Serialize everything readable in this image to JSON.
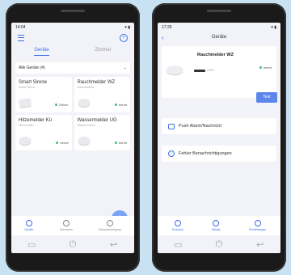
{
  "left": {
    "status_time": "14:04",
    "status_icons": "▾ ▮",
    "add_symbol": "+",
    "tabs": [
      {
        "label": "Geräte"
      },
      {
        "label": "Zimmer"
      }
    ],
    "filter": {
      "label": "Alle Geräte (4)",
      "chevron": "⌄"
    },
    "devices": [
      {
        "name": "Smart Sirene",
        "sub": "Smart Sirene",
        "status": "Online"
      },
      {
        "name": "Rauchmelder WZ",
        "sub": "Rauchmelder",
        "status": "bereit"
      },
      {
        "name": "Hitzemelder Kü",
        "sub": "Hitzemelder",
        "status": "bereit"
      },
      {
        "name": "Wassermelder UG",
        "sub": "Wassermelder",
        "status": "bereit"
      }
    ],
    "fab_label": "+",
    "bottom_nav": [
      {
        "label": "Geräte"
      },
      {
        "label": "Szenarien"
      },
      {
        "label": "Benachrichtigung"
      }
    ],
    "sys_nav": [
      "▭",
      "⏻",
      "↩"
    ]
  },
  "right": {
    "status_time": "17:26",
    "status_icons": "▾ ▮",
    "back_label": "‹",
    "title": "Geräte",
    "device": {
      "name": "Rauchmelder WZ",
      "status": "bereit",
      "battery": "100%"
    },
    "test_button": "Test",
    "rows": [
      {
        "label": "Push Alarm/Nachricht"
      },
      {
        "label": "Fehler Benachrichtigungen"
      }
    ],
    "info_symbol": "i",
    "bottom_nav": [
      {
        "label": "Protokoll"
      },
      {
        "label": "Details"
      },
      {
        "label": "Einstellungen"
      }
    ],
    "sys_nav": [
      "▭",
      "⏻",
      "↩"
    ]
  },
  "colors": {
    "accent": "#3a6ee8",
    "online": "#3cc16b",
    "background": "#c9e2f3"
  }
}
